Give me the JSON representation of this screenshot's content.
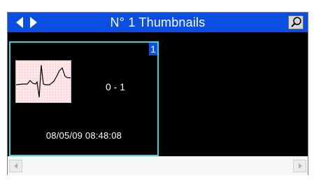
{
  "titlebar": {
    "title": "N° 1 Thumbnails",
    "icons": {
      "prev": "triangle-left-icon",
      "next": "triangle-right-icon",
      "pin": "pin-icon"
    }
  },
  "thumbnail": {
    "index": "1",
    "lead_label": "0 - 1",
    "timestamp": "08/05/09 08:48:08",
    "ecg_image": "ecg-waveform-icon"
  },
  "scrollbar": {
    "left_icon": "scroll-left-icon",
    "right_icon": "scroll-right-icon"
  },
  "colors": {
    "titlebar_bg": "#0a4fe0",
    "panel_bg": "#000000",
    "thumb_border": "#37d5e0",
    "ecg_bg": "#ffe9ea"
  }
}
